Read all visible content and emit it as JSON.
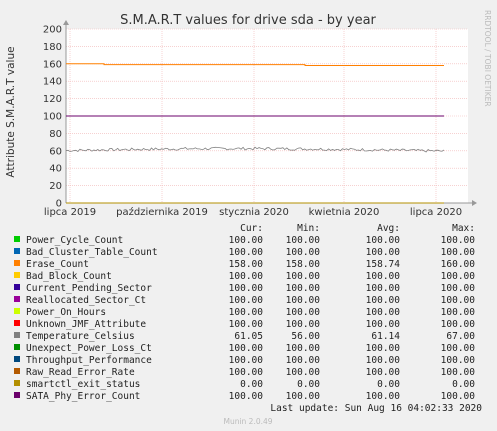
{
  "chart_data": {
    "type": "line",
    "title": "S.M.A.R.T values for drive sda - by year",
    "ylabel": "Attribute S.M.A.R.T value",
    "xlabel": "",
    "side_label": "RRDTOOL / TOBI OETIKER",
    "footer": "Munin 2.0.49",
    "last_update": "Last update:  Sun Aug 16 04:02:33 2020",
    "ylim": [
      0,
      200
    ],
    "y_ticks": [
      "0",
      "20",
      "40",
      "60",
      "80",
      "100",
      "120",
      "140",
      "160",
      "180",
      "200"
    ],
    "x_ticks": [
      "lipca 2019",
      "października 2019",
      "stycznia 2020",
      "kwietnia 2020",
      "lipca 2020"
    ],
    "grid": true,
    "columns": [
      "Cur:",
      "Min:",
      "Avg:",
      "Max:"
    ],
    "series": [
      {
        "name": "Power_Cycle_Count",
        "color": "#00cc00",
        "cur": "100.00",
        "min": "100.00",
        "avg": "100.00",
        "max": "100.00",
        "level": 100
      },
      {
        "name": "Bad_Cluster_Table_Count",
        "color": "#0066b3",
        "cur": "100.00",
        "min": "100.00",
        "avg": "100.00",
        "max": "100.00",
        "level": 100
      },
      {
        "name": "Erase_Count",
        "color": "#ff8000",
        "cur": "158.00",
        "min": "158.00",
        "avg": "158.74",
        "max": "160.00",
        "level": 158
      },
      {
        "name": "Bad_Block_Count",
        "color": "#ffcc00",
        "cur": "100.00",
        "min": "100.00",
        "avg": "100.00",
        "max": "100.00",
        "level": 100
      },
      {
        "name": "Current_Pending_Sector",
        "color": "#330099",
        "cur": "100.00",
        "min": "100.00",
        "avg": "100.00",
        "max": "100.00",
        "level": 100
      },
      {
        "name": "Reallocated_Sector_Ct",
        "color": "#990099",
        "cur": "100.00",
        "min": "100.00",
        "avg": "100.00",
        "max": "100.00",
        "level": 100
      },
      {
        "name": "Power_On_Hours",
        "color": "#ccff00",
        "cur": "100.00",
        "min": "100.00",
        "avg": "100.00",
        "max": "100.00",
        "level": 100
      },
      {
        "name": "Unknown_JMF_Attribute",
        "color": "#ff0000",
        "cur": "100.00",
        "min": "100.00",
        "avg": "100.00",
        "max": "100.00",
        "level": 100
      },
      {
        "name": "Temperature_Celsius",
        "color": "#808080",
        "cur": "61.05",
        "min": "56.00",
        "avg": "61.14",
        "max": "67.00",
        "level": 61
      },
      {
        "name": "Unexpect_Power_Loss_Ct",
        "color": "#008f00",
        "cur": "100.00",
        "min": "100.00",
        "avg": "100.00",
        "max": "100.00",
        "level": 100
      },
      {
        "name": "Throughput_Performance",
        "color": "#00487d",
        "cur": "100.00",
        "min": "100.00",
        "avg": "100.00",
        "max": "100.00",
        "level": 100
      },
      {
        "name": "Raw_Read_Error_Rate",
        "color": "#b35a00",
        "cur": "100.00",
        "min": "100.00",
        "avg": "100.00",
        "max": "100.00",
        "level": 100
      },
      {
        "name": "smartctl_exit_status",
        "color": "#b38f00",
        "cur": "0.00",
        "min": "0.00",
        "avg": "0.00",
        "max": "0.00",
        "level": 0
      },
      {
        "name": "SATA_Phy_Error_Count",
        "color": "#6b006b",
        "cur": "100.00",
        "min": "100.00",
        "avg": "100.00",
        "max": "100.00",
        "level": 100
      }
    ]
  }
}
